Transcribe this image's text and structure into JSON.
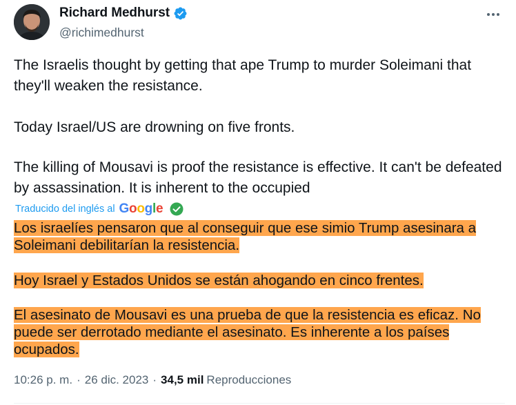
{
  "author": {
    "display_name": "Richard Medhurst",
    "handle": "@richimedhurst"
  },
  "tweet": {
    "paragraphs": [
      "The Israelis thought by getting that ape Trump to murder Soleimani that they'll weaken the resistance.",
      "Today Israel/US are drowning on five fronts.",
      "The killing of Mousavi is proof the resistance is effective. It can't be defeated by assassination. It is inherent to the occupied"
    ]
  },
  "translation": {
    "label": "Traducido del inglés al",
    "provider": "Google",
    "paragraphs": [
      "Los israelíes pensaron que al conseguir que ese simio Trump asesinara a Soleimani debilitarían la resistencia.",
      "Hoy Israel y Estados Unidos se están ahogando en cinco frentes.",
      "El asesinato de Mousavi es una prueba de que la resistencia es eficaz. No puede ser derrotado mediante el asesinato. Es inherente a los países ocupados."
    ],
    "highlight_color": "#ffa64d"
  },
  "meta": {
    "time": "10:26 p. m.",
    "separator": "·",
    "date": "26 dic. 2023",
    "views_count": "34,5 mil",
    "views_label": "Reproducciones"
  },
  "colors": {
    "verified": "#1d9bf0",
    "link": "#1d9bf0",
    "secondary_text": "#536471"
  }
}
